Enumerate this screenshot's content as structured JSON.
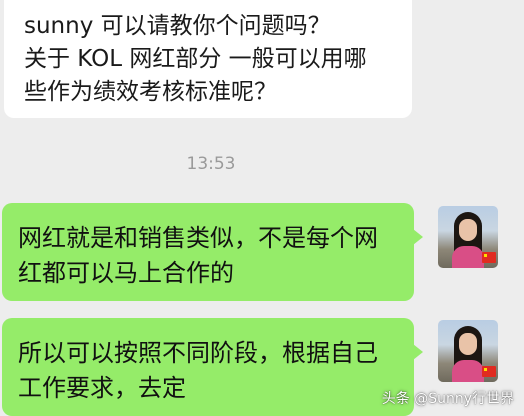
{
  "colors": {
    "background": "#ededed",
    "incoming_bubble": "#ffffff",
    "outgoing_bubble": "#95ec69",
    "timestamp_text": "#9a9a9a"
  },
  "messages": [
    {
      "sender": "other",
      "lines": [
        "sunny   可以请教你个问题吗？",
        "关于 KOL 网红部分 一般可以用哪",
        "些作为绩效考核标准呢？"
      ]
    },
    {
      "sender": "self",
      "lines": [
        "网红就是和销售类似，不是每个网",
        "红都可以马上合作的"
      ]
    },
    {
      "sender": "self",
      "lines": [
        "所以可以按照不同阶段，根据自己",
        "工作要求，去定"
      ]
    }
  ],
  "timestamp": "13:53",
  "watermark": "头条 @Sunny行世界"
}
